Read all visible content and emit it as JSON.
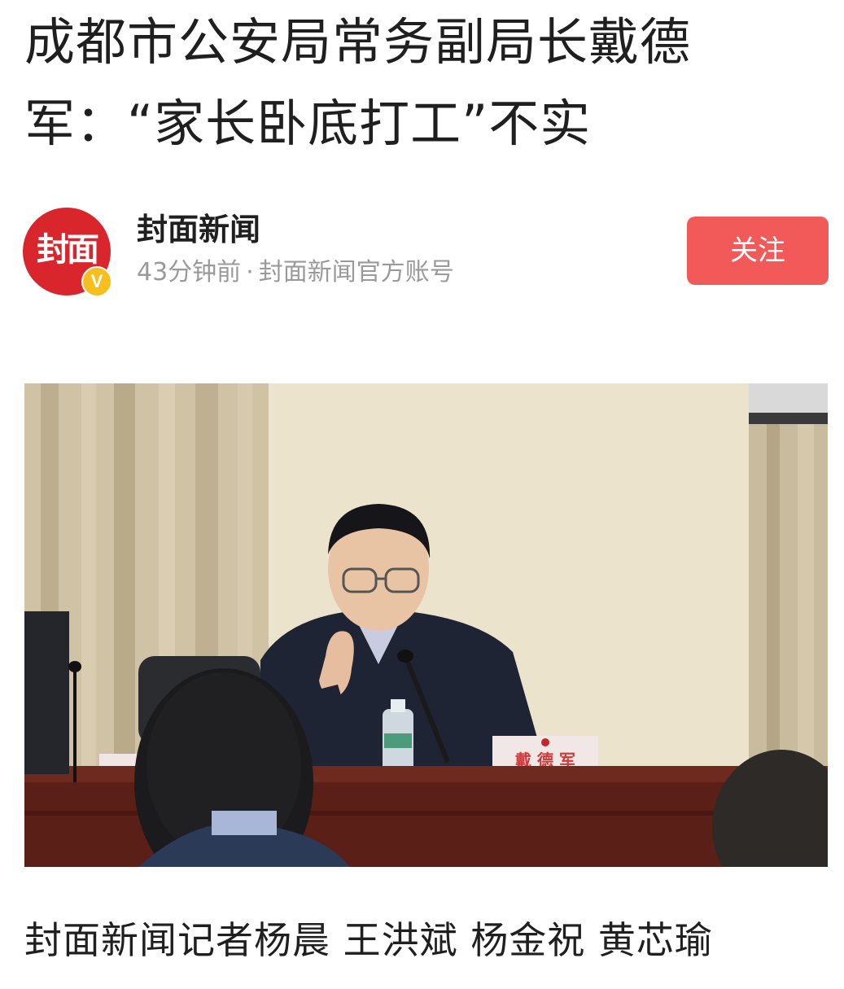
{
  "article": {
    "headline": "成都市公安局常务副局长戴德军：“家长卧底打工”不实",
    "byline": "封面新闻记者杨晨 王洪斌 杨金祝 黄芯瑜"
  },
  "author": {
    "avatar_text": "封面",
    "verified_mark": "V",
    "name": "封面新闻",
    "time_ago": "43分钟前",
    "separator": "·",
    "account_type": "封面新闻官方账号",
    "follow_label": "关注"
  },
  "photo": {
    "nameplate_text": "戴 德 军"
  },
  "colors": {
    "follow_button": "#f25a5a",
    "avatar_brand": "#d8262c",
    "verified_badge": "#f6bf1d",
    "meta_text": "#9a9a9a"
  }
}
